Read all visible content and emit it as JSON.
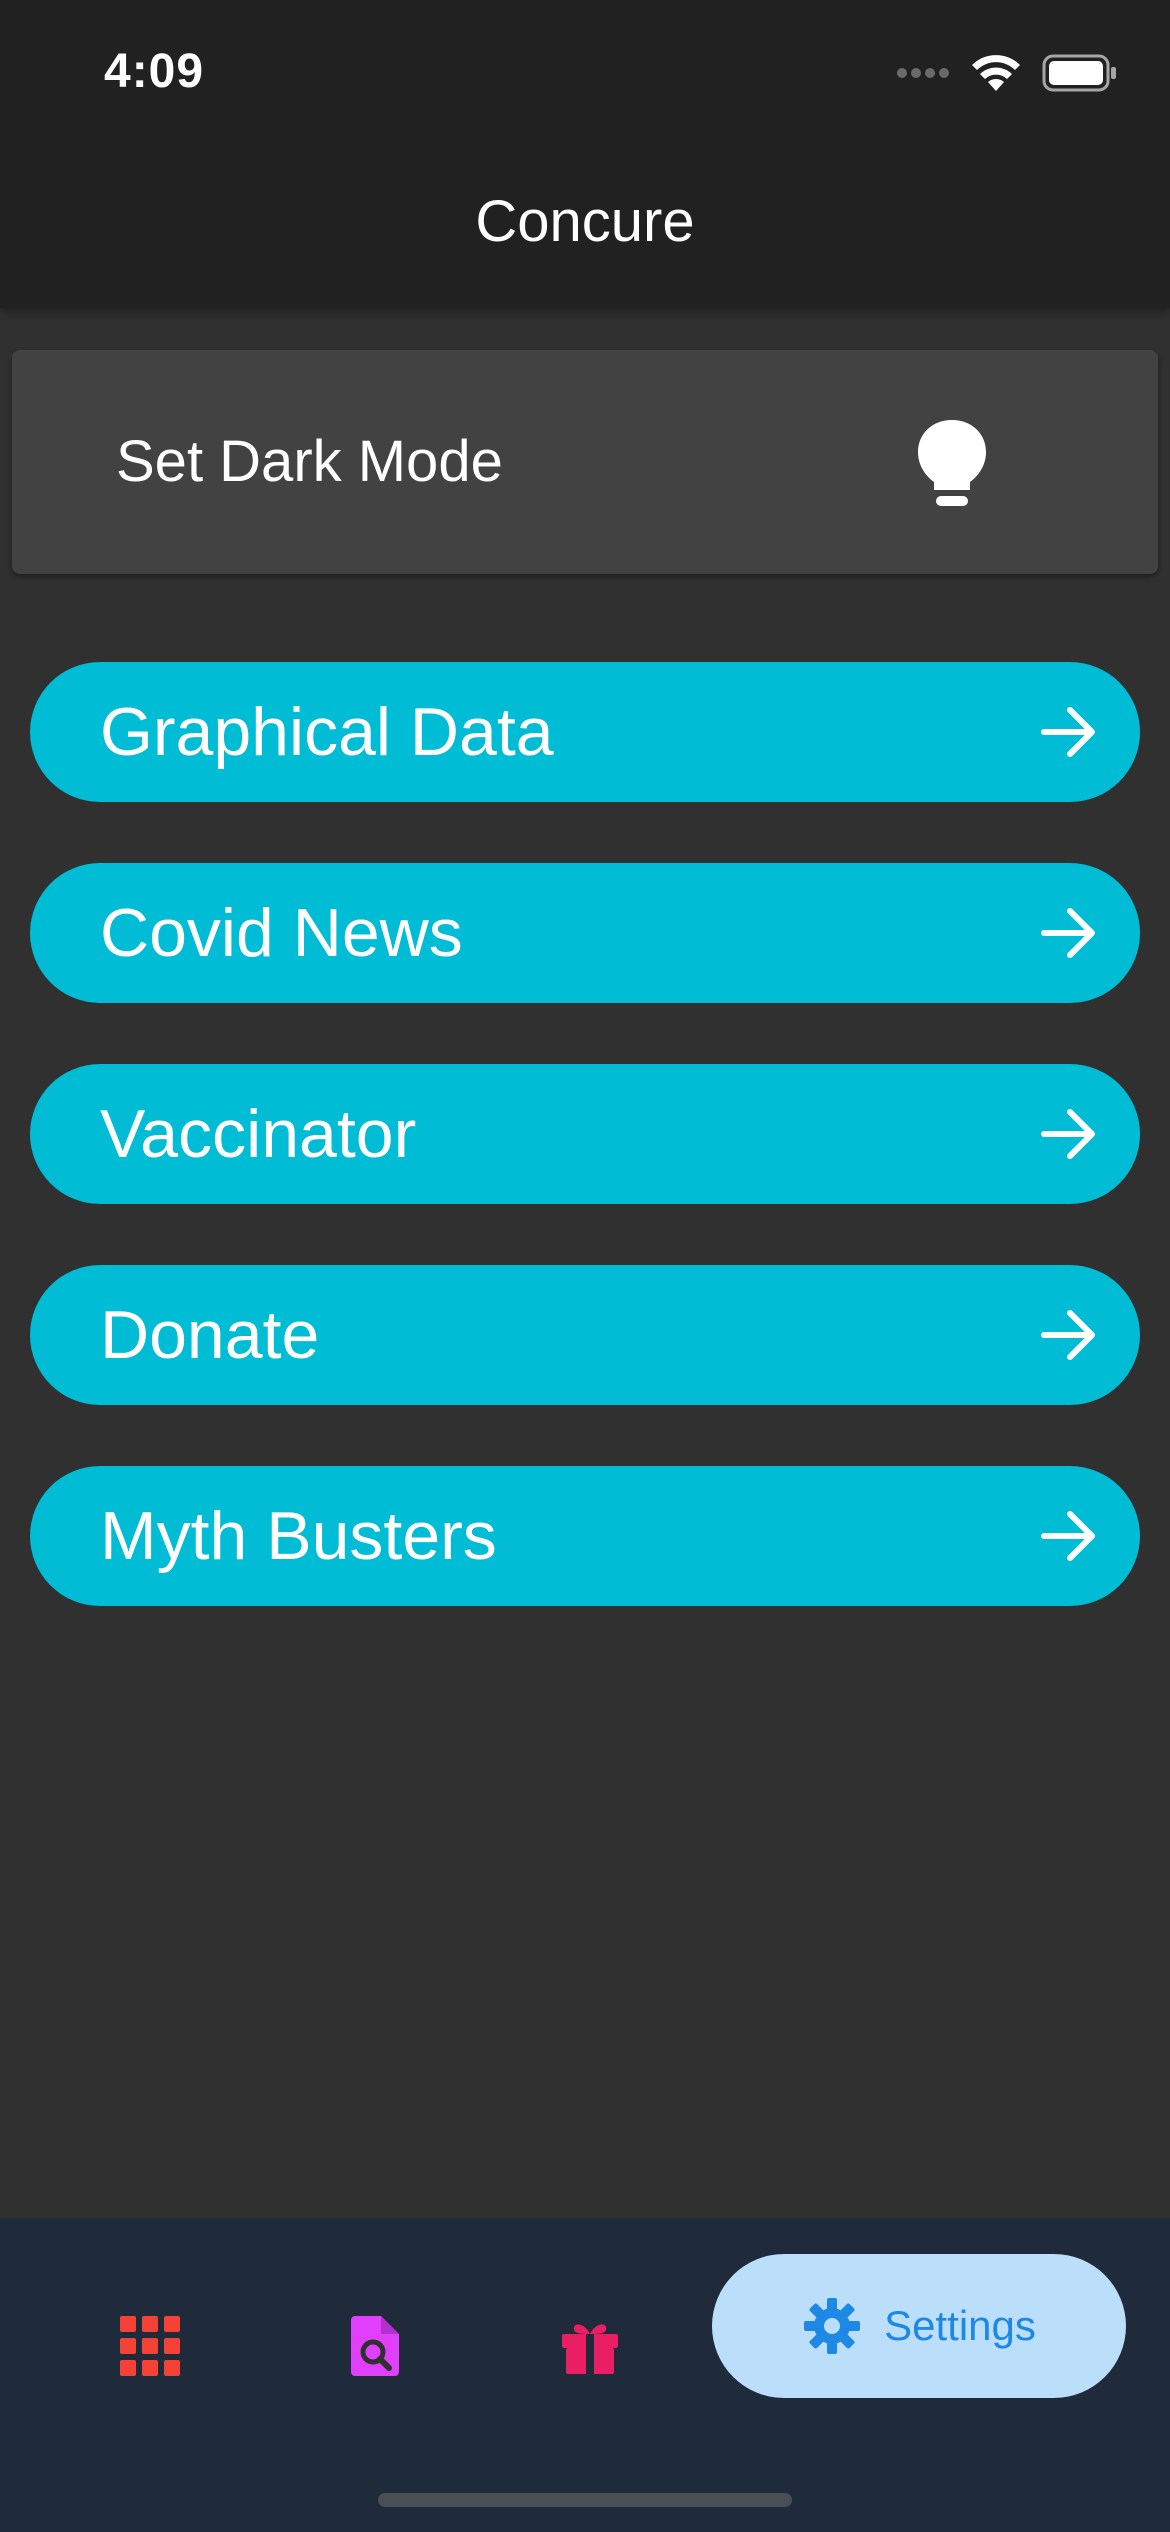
{
  "status_bar": {
    "time": "4:09",
    "icons": [
      "cellular-dots-icon",
      "wifi-icon",
      "battery-icon"
    ]
  },
  "app_bar": {
    "title": "Concure"
  },
  "dark_mode_card": {
    "label": "Set Dark Mode",
    "icon": "lightbulb-icon"
  },
  "menu": {
    "items": [
      {
        "label": "Graphical Data",
        "icon": "arrow-right-icon"
      },
      {
        "label": "Covid News",
        "icon": "arrow-right-icon"
      },
      {
        "label": "Vaccinator",
        "icon": "arrow-right-icon"
      },
      {
        "label": "Donate",
        "icon": "arrow-right-icon"
      },
      {
        "label": "Myth Busters",
        "icon": "arrow-right-icon"
      }
    ]
  },
  "bottom_nav": {
    "items": [
      {
        "icon": "grid-apps-icon",
        "color": "#f44336"
      },
      {
        "icon": "document-search-icon",
        "color": "#e040fb"
      },
      {
        "icon": "gift-icon",
        "color": "#e91e63"
      },
      {
        "icon": "gear-icon",
        "label": "Settings",
        "color": "#1e88e5",
        "selected": true
      }
    ]
  },
  "colors": {
    "background": "#303030",
    "app_bar": "#212121",
    "card": "#424242",
    "accent": "#00bcd4",
    "nav_background": "#1f2a3a",
    "nav_selected_bg": "#bbdefb"
  }
}
